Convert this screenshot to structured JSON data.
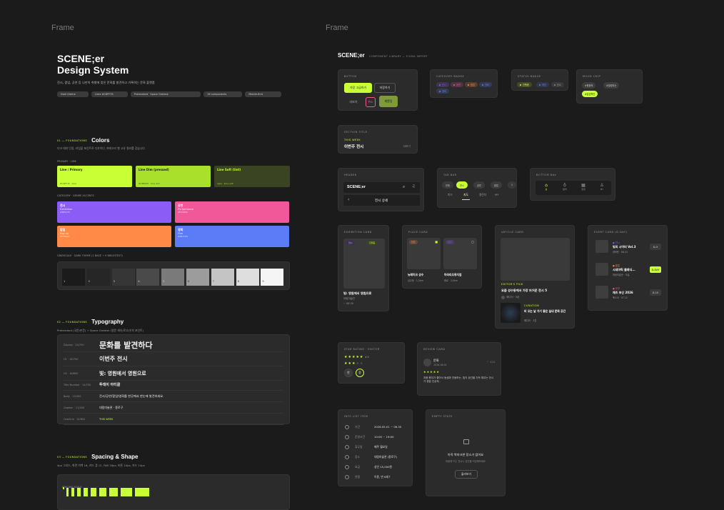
{
  "frames": {
    "left_label": "Frame",
    "right_label": "Frame"
  },
  "design_system": {
    "logo": "SCENE;er",
    "title": "Design System",
    "desc": "전시, 팝업, 공연 등 나만의 취향에 맞은 문화를 발견하고 기록하는 문화 플랫폼",
    "tags": [
      "Dark theme",
      "Lime #C8FF35",
      "Pretendard · Space Grotesk",
      "26 components",
      "Mobile-first"
    ],
    "colors": {
      "sec_tag": "01 — FOUNDATIONS",
      "title": "Colors",
      "desc": "다크 테마 단일, 라임을 포인트로 디자이너, 카테고리 별 고유 컬러를 갖습니다.",
      "primary_label": "PRIMARY · LIME",
      "primary": [
        {
          "name": "Line / Primary",
          "hex": "#C8FF35 · lime",
          "color": "#c8ff35",
          "fg": "#1b1b1b"
        },
        {
          "name": "Line Dim (pressed)",
          "hex": "#A8E62E · lime dim",
          "color": "#a8e02b",
          "fg": "#1b1b1b"
        },
        {
          "name": "Line Soft (tint)",
          "hex": "rgba · lime soft",
          "color": "#3a4422",
          "fg": "#c8ff35"
        }
      ],
      "category_label": "CATEGORY · GENRE ACCENTS",
      "categories": [
        {
          "name": "전시",
          "en": "Exhibition",
          "hex": "#8B5CF6",
          "color": "#8b5cf6"
        },
        {
          "name": "공연",
          "en": "Performance",
          "hex": "#F0589A",
          "color": "#f0589a"
        },
        {
          "name": "팝업",
          "en": "Pop-up",
          "hex": "#FF8A47",
          "color": "#ff8a47"
        },
        {
          "name": "영화",
          "en": "Film",
          "hex": "#5B7CF6",
          "color": "#5b7cf6"
        }
      ],
      "gray_label": "GRAYSCALE · DARK THEME (1 BASE → 9 BRIGHTEST)",
      "grays": [
        {
          "n": "1",
          "c": "#1b1b1b"
        },
        {
          "n": "2",
          "c": "#262626"
        },
        {
          "n": "3",
          "c": "#363636"
        },
        {
          "n": "4",
          "c": "#4a4a4a"
        },
        {
          "n": "5",
          "c": "#7a7a7a"
        },
        {
          "n": "6",
          "c": "#9c9c9c"
        },
        {
          "n": "7",
          "c": "#c4c4c4"
        },
        {
          "n": "8",
          "c": "#dedede"
        },
        {
          "n": "9",
          "c": "#f5f5f5"
        }
      ]
    },
    "typography": {
      "sec_tag": "02 — FOUNDATIONS",
      "title": "Typography",
      "desc": "Pretendard (국문/본문) + Space Grotesk (영문 헤더/로고/숫자 포인트)",
      "rows": [
        {
          "label": "Display · 24/700",
          "sample": "문화를 발견하다",
          "size": 11
        },
        {
          "label": "H1 · 18/700",
          "sample": "이번주 전시",
          "size": 8
        },
        {
          "label": "H2 · 16/600",
          "sample": "빛: 영원에서 영원으로",
          "size": 7
        },
        {
          "label": "Title Number · 14/700",
          "sample": "투데이 아티클",
          "size": 5
        },
        {
          "label": "Body · 13/400",
          "sample": "전시/공연/팝업/영화를 한곳에서 한눈에 발견하세요.",
          "size": 4.2
        },
        {
          "label": "Caption · 11/400",
          "sample": "대림미술관 · 종로구",
          "size": 4
        },
        {
          "label": "Overline · 10/600",
          "sample": "THIS WEEK",
          "size": 3.5,
          "lime": true
        }
      ]
    },
    "spacing": {
      "sec_tag": "03 — FOUNDATIONS",
      "title": "Spacing & Shape",
      "desc": "4px 그리드, 화면 여백 16, 카드 갭 12, FAB 16px, 버튼 10px, 카드 14px",
      "scale_label": "SPACING SCALE"
    }
  },
  "library": {
    "logo": "SCENE;er",
    "subtitle": "COMPONENT LIBRARY — FIGMA IMPORT",
    "button": {
      "title": "BUTTON",
      "primary": "가장 고급하기",
      "secondary": "저장하기",
      "ghost": "더보기",
      "danger": "취소",
      "filter": "예쁨링"
    },
    "category_badge": {
      "title": "CATEGORY BADGE",
      "items": [
        {
          "label": "전시",
          "color": "#8b5cf6"
        },
        {
          "label": "공연",
          "color": "#f0589a"
        },
        {
          "label": "팝업",
          "color": "#ff8a47"
        },
        {
          "label": "영화",
          "color": "#5b7cf6"
        },
        {
          "label": "영화",
          "color": "#5b7cf6"
        }
      ]
    },
    "status_badge": {
      "title": "STATUS BADGE",
      "items": [
        {
          "label": "진행중",
          "color": "#c8ff35"
        },
        {
          "label": "예정",
          "color": "#5b7cf6"
        },
        {
          "label": "종료",
          "color": "#8a8a8a"
        }
      ]
    },
    "mood_chip": {
      "title": "MOOD CHIP",
      "items": [
        "#몽환적",
        "#힐링되는",
        "#감성적인"
      ]
    },
    "section_title": {
      "title": "SECTION TITLE",
      "tag": "THIS WEEK",
      "heading": "이번주 전시",
      "more": "더보기"
    },
    "header": {
      "title": "HEADER",
      "logo": "SCENE;er",
      "sub": "전시 상세"
    },
    "tab_bar": {
      "title": "TAB BAR",
      "pills": [
        "전체",
        "전시",
        "공연",
        "팝업",
        "1"
      ],
      "tabs": [
        "피드",
        "지도",
        "캘린더",
        "MY"
      ]
    },
    "bottom_nav": {
      "title": "BOTTOM NAV",
      "items": [
        "홈",
        "탐색",
        "일정",
        "MY"
      ]
    },
    "exhibition_card": {
      "title": "EXHIBITION CARD",
      "badge_cat": "전시",
      "badge_status": "진행중",
      "name": "빛: 영원에서 영원으로",
      "venue": "대림미술관",
      "date": "~ 08.30"
    },
    "place_card": {
      "title": "PLACE CARD",
      "items": [
        {
          "cat": "팝업",
          "name": "뉴테이크 성수",
          "meta": "성수동 · 1.2km"
        },
        {
          "cat": "전시",
          "name": "아라리오뮤지엄",
          "meta": "종로 · 3.0km"
        }
      ]
    },
    "article_card": {
      "title": "ARTICLE CARD",
      "pick": "EDITOR'S PICK",
      "headline": "요즘 성수동에서 가장 뜨거운 전시 5",
      "author": "에디터 · 5분",
      "sub_tag": "CURATION",
      "sub_headline": "비 오는 날 가기 좋은 실내 문화 공간",
      "sub_meta": "에디터 · 3분"
    },
    "event_card": {
      "title": "EVENT CARD (D-DAY)",
      "items": [
        {
          "cat": "전시",
          "name": "빛의 시어터 Vol.3",
          "meta": "광화문 · 08.24",
          "dday": "D-3",
          "lime": false
        },
        {
          "cat": "팝업",
          "name": "시네마틱 클래식...",
          "meta": "대림미술관 · 오늘",
          "dday": "D-DAY",
          "lime": true
        },
        {
          "cat": "공연",
          "name": "재즈 부산 2026",
          "meta": "벡스코 · 07.12",
          "dday": "D-15",
          "lime": false
        }
      ]
    },
    "star_rating": {
      "title": "STAR RATING · EDITOR",
      "score": "4.5",
      "chips": [
        "한",
        "중"
      ]
    },
    "review_card": {
      "title": "REVIEW CARD",
      "name": "문화",
      "date": "2026.06.01",
      "likes": "124",
      "text": "처음 봤지가 좋아서 동생과 찬동하는, 빛이 공간을 가득 채우는 전시가 정말 인상적.."
    },
    "info_list": {
      "title": "INFO LIST ITEM",
      "rows": [
        {
          "k": "기간",
          "v": "2026.05.01 ~ 06.30"
        },
        {
          "k": "운영시간",
          "v": "10:00 ~ 19:00"
        },
        {
          "k": "휴무일",
          "v": "매주 월요일"
        },
        {
          "k": "장소",
          "v": "대림미술관 (종로구)"
        },
        {
          "k": "요금",
          "v": "성인 15,000원"
        },
        {
          "k": "연령",
          "v": "이용, 만 6세↑"
        }
      ]
    },
    "empty_state": {
      "title": "EMPTY STATE",
      "heading": "아직 북마크한 장소가 없어요",
      "desc": "마음에 드는 전시나 공간을 저장해보세요",
      "button": "둘러보기"
    }
  }
}
